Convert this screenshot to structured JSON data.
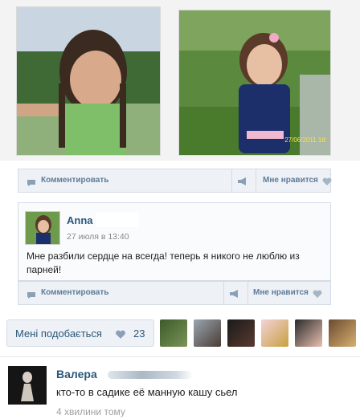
{
  "post": {
    "comment_label": "Комментировать",
    "like_label": "Мне нравится"
  },
  "comment": {
    "author": "Anna",
    "date": "27 июля в 13:40",
    "text": "Мне разбили сердце на всегда! теперь я никого не люблю из парней!",
    "comment_label": "Комментировать",
    "like_label": "Мне нравится"
  },
  "photo_right": {
    "date_stamp": "27/06/2011 18:"
  },
  "likes": {
    "label": "Мені подобається",
    "count": "23"
  },
  "reply": {
    "author": "Валера",
    "text": "кто-то в садике её манную кашу сьел",
    "time": "4 хвилини тому"
  },
  "colors": {
    "link": "#2b587a",
    "bar_bg": "#eef1f5",
    "bar_text": "#5f7b99"
  }
}
